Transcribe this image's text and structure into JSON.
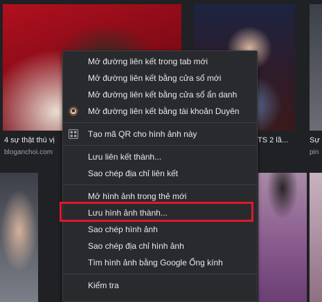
{
  "results_row1": {
    "caption_left": "4 sự thật thú vị",
    "source_left": "bloganchoi.com",
    "caption_mid": "TS 2 lầ...",
    "caption_right": "Sự th",
    "source_right": "pin"
  },
  "context_menu": {
    "items": [
      {
        "label": "Mở đường liên kết trong tab mới"
      },
      {
        "label": "Mở đường liên kết bằng cửa sổ mới"
      },
      {
        "label": "Mở đường liên kết bằng cửa sổ ẩn danh"
      },
      {
        "label": "Mở đường liên kết bằng tài khoản Duyên",
        "icon": "profile-avatar-icon"
      },
      {
        "label": "Tạo mã QR cho hình ảnh này",
        "icon": "qr-code-icon"
      },
      {
        "label": "Lưu liên kết thành..."
      },
      {
        "label": "Sao chép địa chỉ liên kết"
      },
      {
        "label": "Mở hình ảnh trong thẻ mới"
      },
      {
        "label": "Lưu hình ảnh thành...",
        "highlighted": true
      },
      {
        "label": "Sao chép hình ảnh"
      },
      {
        "label": "Sao chép địa chỉ hình ảnh"
      },
      {
        "label": "Tìm hình ảnh bằng Google Ống kính"
      },
      {
        "label": "Kiểm tra"
      }
    ]
  },
  "colors": {
    "menu_bg": "#292a2d",
    "highlight": "#e0182a",
    "text": "#e8eaed"
  }
}
